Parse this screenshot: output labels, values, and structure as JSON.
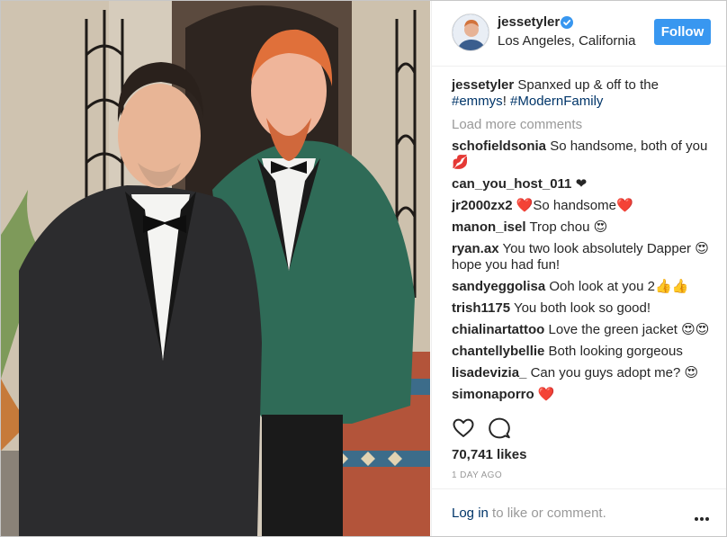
{
  "post": {
    "username": "jessetyler",
    "location": "Los Angeles, California",
    "follow_label": "Follow",
    "caption_user": "jessetyler",
    "caption_text": "Spanxed up & off to the",
    "caption_tag1": "#emmys",
    "caption_mid": "!",
    "caption_tag2": "#ModernFamily",
    "load_more": "Load more comments",
    "likes": "70,741 likes",
    "date": "1 DAY AGO",
    "login_link": "Log in",
    "login_rest": " to like or comment."
  },
  "comments": [
    {
      "user": "schofieldsonia",
      "text": "So handsome, both of you 💋"
    },
    {
      "user": "can_you_host_011",
      "text": "❤"
    },
    {
      "user": "jr2000zx2",
      "text": "❤️So handsome❤️"
    },
    {
      "user": "manon_isel",
      "text": "Trop chou 😍"
    },
    {
      "user": "ryan.ax",
      "text": "You two look absolutely Dapper 😍 hope you had fun!"
    },
    {
      "user": "sandyeggolisa",
      "text": "Ooh look at you 2👍👍"
    },
    {
      "user": "trish1175",
      "text": "You both look so good!"
    },
    {
      "user": "chialinartattoo",
      "text": "Love the green jacket 😍😍"
    },
    {
      "user": "chantellybellie",
      "text": "Both looking gorgeous"
    },
    {
      "user": "lisadevizia_",
      "text": "Can you guys adopt me? 😍"
    },
    {
      "user": "simonaporro",
      "text": "❤️"
    }
  ],
  "icons": {
    "verified": "verified-badge-icon",
    "like": "heart-icon",
    "comment": "comment-bubble-icon",
    "more": "ellipsis-icon"
  },
  "colors": {
    "accent": "#3897f0",
    "hashtag": "#003569",
    "muted": "#999999",
    "text": "#262626"
  }
}
